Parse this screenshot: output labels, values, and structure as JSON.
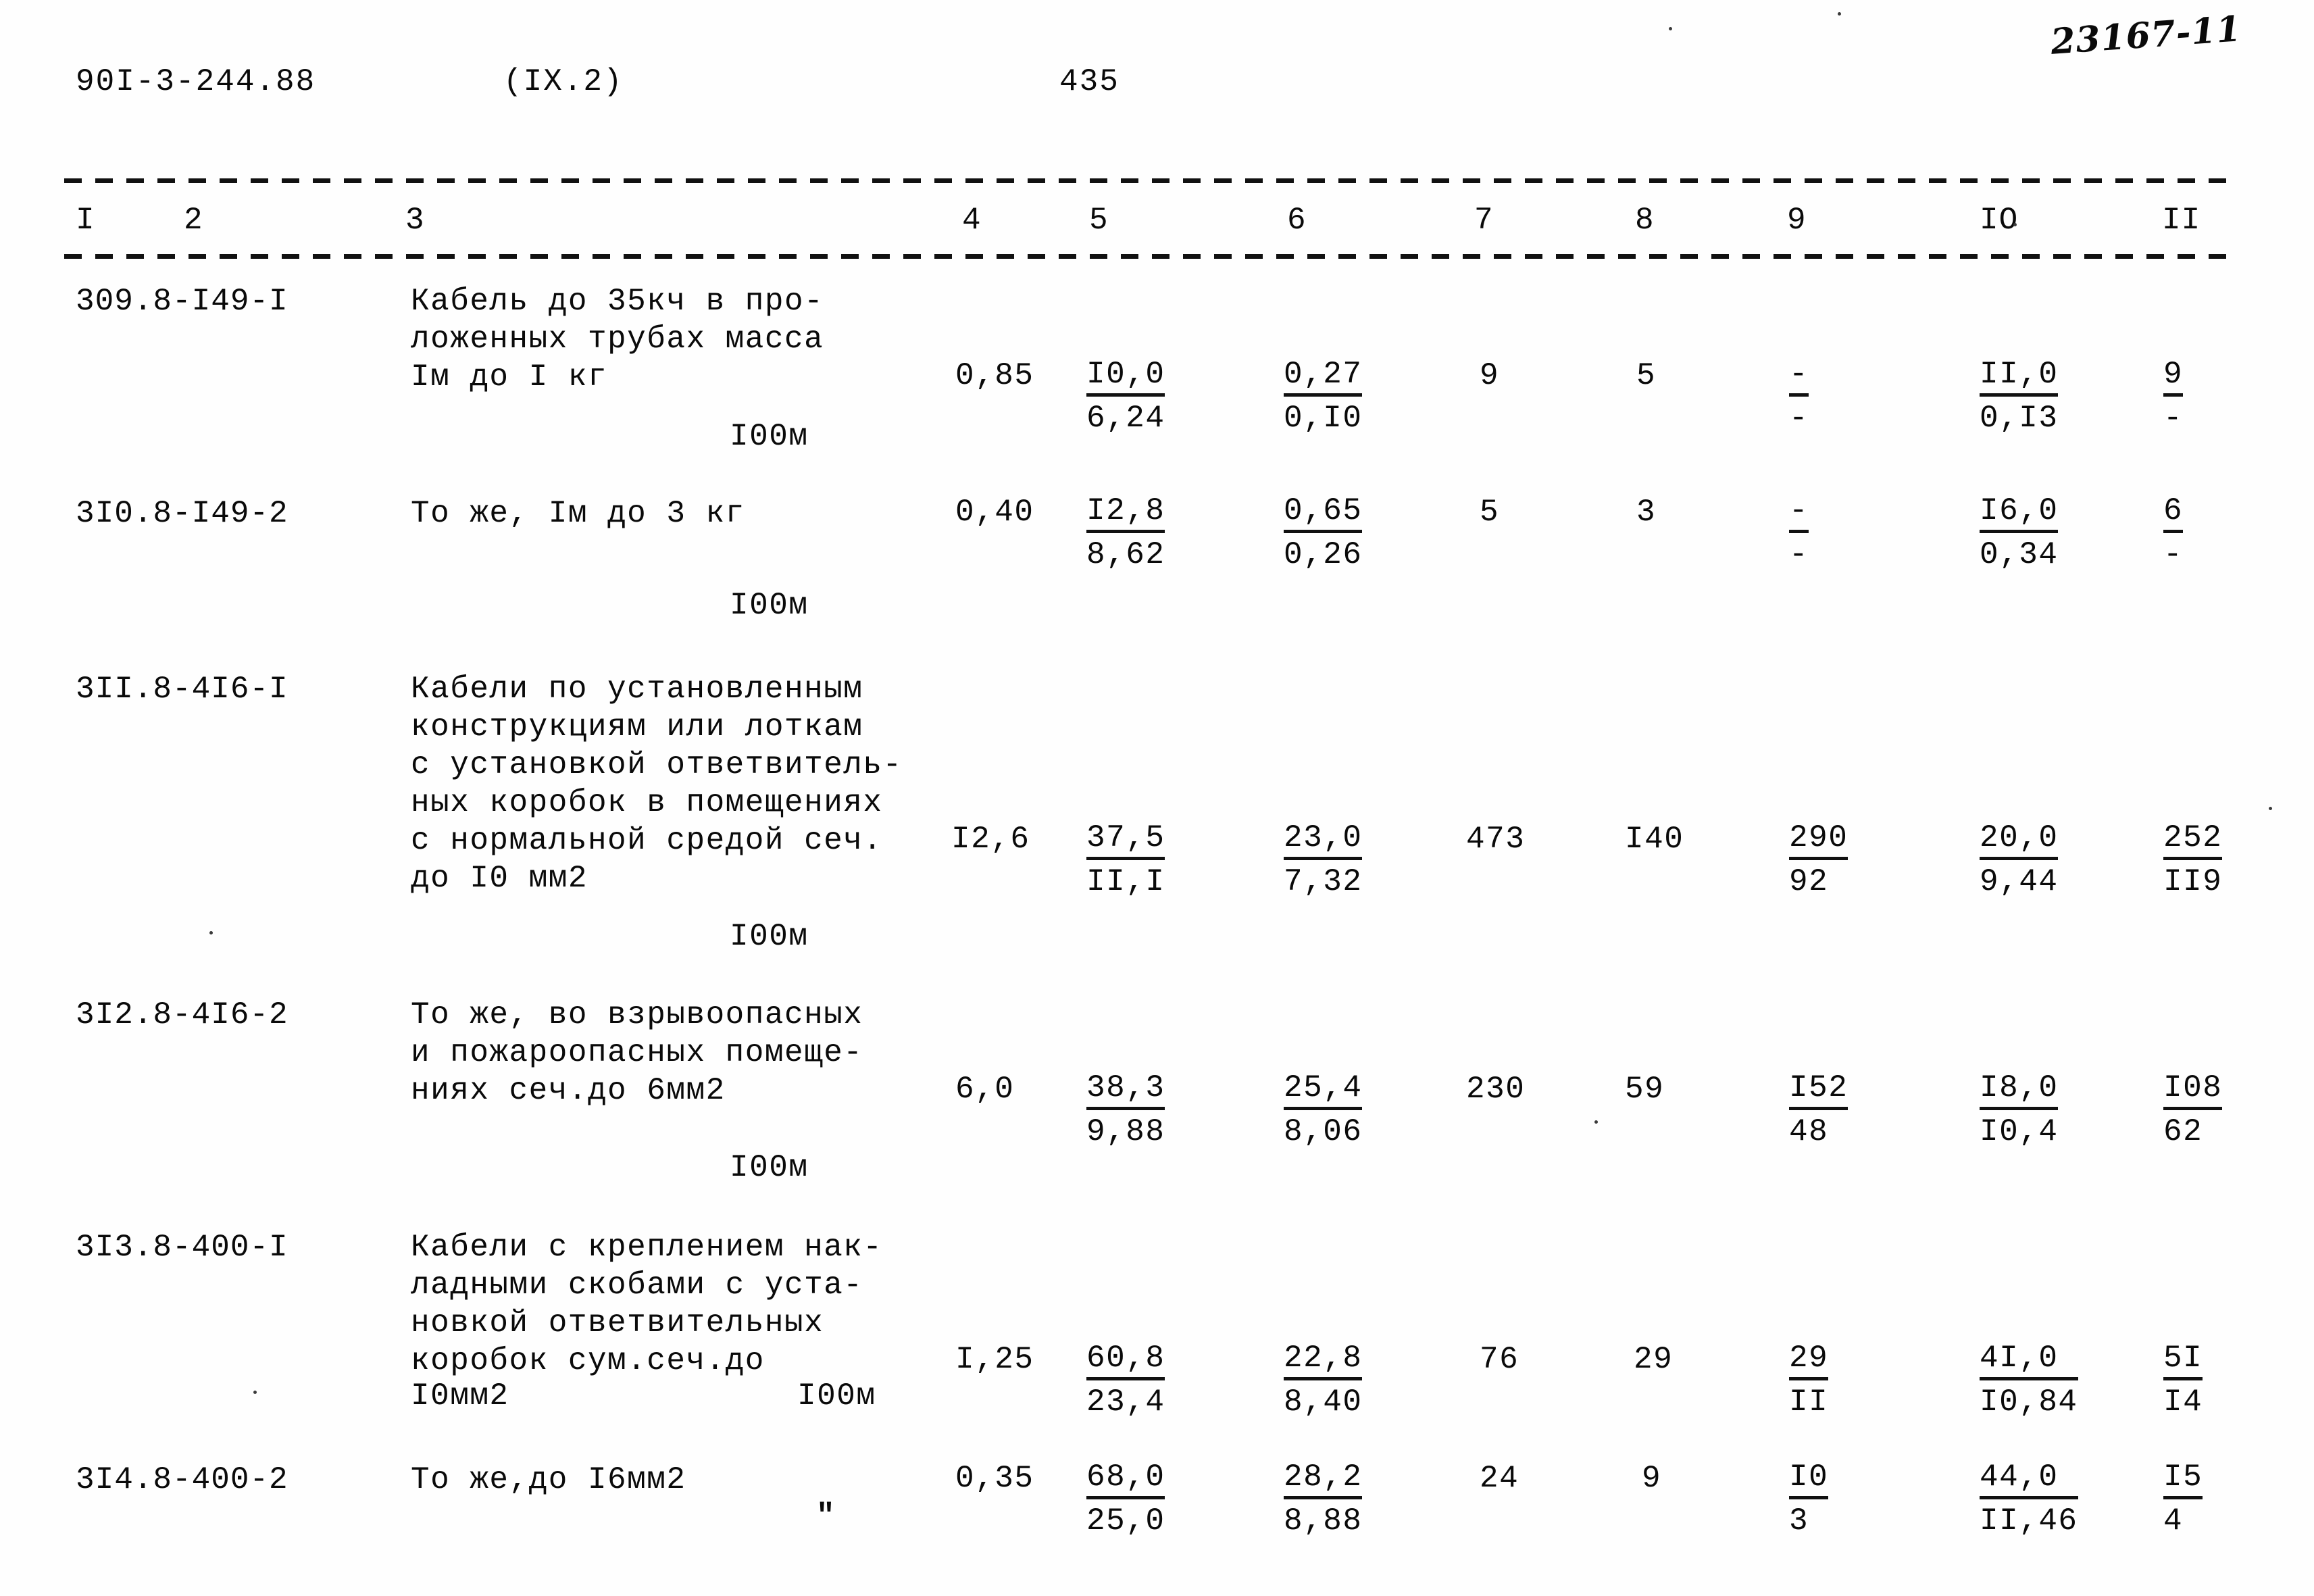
{
  "header": {
    "document_code": "90I-3-244.88",
    "section": "(IX.2)",
    "page_number": "435",
    "handwritten_note": "23167-11"
  },
  "table": {
    "column_headers": [
      "I",
      "2",
      "3",
      "4",
      "5",
      "6",
      "7",
      "8",
      "9",
      "IO",
      "II"
    ],
    "rows": [
      {
        "code": "309.8-I49-I",
        "description_lines": [
          "Кабель до 35кч в про-",
          "ложенных трубах масса",
          "Iм до I кг"
        ],
        "unit": "I00м",
        "c4": "0,85",
        "c5_top": "I0,0",
        "c5_bot": "6,24",
        "c6_top": "0,27",
        "c6_bot": "0,I0",
        "c7": "9",
        "c8": "5",
        "c9_top": "-",
        "c9_bot": "-",
        "c10_top": "II,0",
        "c10_bot": "0,I3",
        "c11_top": "9",
        "c11_bot": "-"
      },
      {
        "code": "3I0.8-I49-2",
        "description_lines": [
          "То же, Iм до 3 кг"
        ],
        "unit": "I00м",
        "c4": "0,40",
        "c5_top": "I2,8",
        "c5_bot": "8,62",
        "c6_top": "0,65",
        "c6_bot": "0,26",
        "c7": "5",
        "c8": "3",
        "c9_top": "-",
        "c9_bot": "-",
        "c10_top": "I6,0",
        "c10_bot": "0,34",
        "c11_top": "6",
        "c11_bot": "-"
      },
      {
        "code": "3II.8-4I6-I",
        "description_lines": [
          "Кабели по установленным",
          "конструкциям или лоткам",
          "с установкой ответвитель-",
          "ных коробок в помещениях",
          "с нормальной средой сеч.",
          "до I0 мм2"
        ],
        "unit": "I00м",
        "c4": "I2,6",
        "c5_top": "37,5",
        "c5_bot": "II,I",
        "c6_top": "23,0",
        "c6_bot": "7,32",
        "c7": "473",
        "c8": "I40",
        "c9_top": "290",
        "c9_bot": "92",
        "c10_top": "20,0",
        "c10_bot": "9,44",
        "c11_top": "252",
        "c11_bot": "II9"
      },
      {
        "code": "3I2.8-4I6-2",
        "description_lines": [
          "То же, во взрывоопасных",
          "и пожароопасных помеще-",
          "ниях сеч.до 6мм2"
        ],
        "unit": "I00м",
        "c4": "6,0",
        "c5_top": "38,3",
        "c5_bot": "9,88",
        "c6_top": "25,4",
        "c6_bot": "8,06",
        "c7": "230",
        "c8": "59",
        "c9_top": "I52",
        "c9_bot": "48",
        "c10_top": "I8,0",
        "c10_bot": "I0,4",
        "c11_top": "I08",
        "c11_bot": "62"
      },
      {
        "code": "3I3.8-400-I",
        "description_lines": [
          "Кабели с креплением нак-",
          "ладными скобами с уста-",
          "новкой ответвительных",
          "коробок сум.сеч.до",
          "I0мм2"
        ],
        "unit": "I00м",
        "c4": "I,25",
        "c5_top": "60,8",
        "c5_bot": "23,4",
        "c6_top": "22,8",
        "c6_bot": "8,40",
        "c7": "76",
        "c8": "29",
        "c9_top": "29",
        "c9_bot": "II",
        "c10_top": "4I,0",
        "c10_bot": "I0,84",
        "c11_top": "5I",
        "c11_bot": "I4"
      },
      {
        "code": "3I4.8-400-2",
        "description_lines": [
          "То же,до I6мм2"
        ],
        "unit": "\"",
        "c4": "0,35",
        "c5_top": "68,0",
        "c5_bot": "25,0",
        "c6_top": "28,2",
        "c6_bot": "8,88",
        "c7": "24",
        "c8": "9",
        "c9_top": "I0",
        "c9_bot": "3",
        "c10_top": "44,0",
        "c10_bot": "II,46",
        "c11_top": "I5",
        "c11_bot": "4"
      }
    ]
  }
}
